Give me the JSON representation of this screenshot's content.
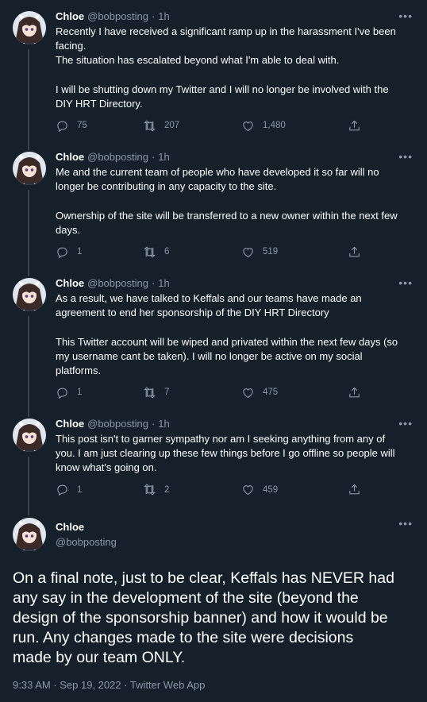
{
  "tweets": [
    {
      "name": "Chloe",
      "handle": "@bobposting",
      "dot": "·",
      "time": "1h",
      "text": "Recently I have received a significant ramp up in the harassment I've been\nfacing.\nThe situation has escalated beyond what I'm able to deal with.\n\nI will be shutting down my Twitter and I will no longer be involved with the\nDIY HRT Directory.",
      "replies": "75",
      "retweets": "207",
      "likes": "1,480"
    },
    {
      "name": "Chloe",
      "handle": "@bobposting",
      "dot": "·",
      "time": "1h",
      "text": "Me and the current team of people who have developed it so far will no\nlonger be contributing in any capacity to the site.\n\nOwnership of the site will be transferred to a new owner within the next few\ndays.",
      "replies": "1",
      "retweets": "6",
      "likes": "519"
    },
    {
      "name": "Chloe",
      "handle": "@bobposting",
      "dot": "·",
      "time": "1h",
      "text": "As a result, we have talked to Keffals and our teams have made an\nagreement to end her sponsorship of the DIY HRT Directory\n\nThis Twitter account will be wiped and privated within the next few days (so\nmy username cant be taken). I will no longer be active on my social\nplatforms.",
      "replies": "1",
      "retweets": "7",
      "likes": "475"
    },
    {
      "name": "Chloe",
      "handle": "@bobposting",
      "dot": "·",
      "time": "1h",
      "text": "This post isn't to garner sympathy nor am I seeking anything from any of\nyou. I am just clearing up these few things before I go offline so people will\nknow what's going on.",
      "replies": "1",
      "retweets": "2",
      "likes": "459"
    }
  ],
  "main": {
    "name": "Chloe",
    "handle": "@bobposting",
    "text": "On a final note, just to be clear, Keffals has NEVER had\nany say in the development of the site (beyond the\ndesign of the sponsorship banner) and how it would be\nrun. Any changes made to the site were decisions\nmade by our team ONLY.",
    "meta": "9:33 AM · Sep 19, 2022 · Twitter Web App"
  },
  "more_label": "•••",
  "colors": {
    "background": "#15202b",
    "secondary_text": "#8b98a5",
    "thread_line": "#38444d"
  },
  "icons": [
    "reply-icon",
    "retweet-icon",
    "like-icon",
    "share-icon",
    "more-icon",
    "avatar"
  ]
}
